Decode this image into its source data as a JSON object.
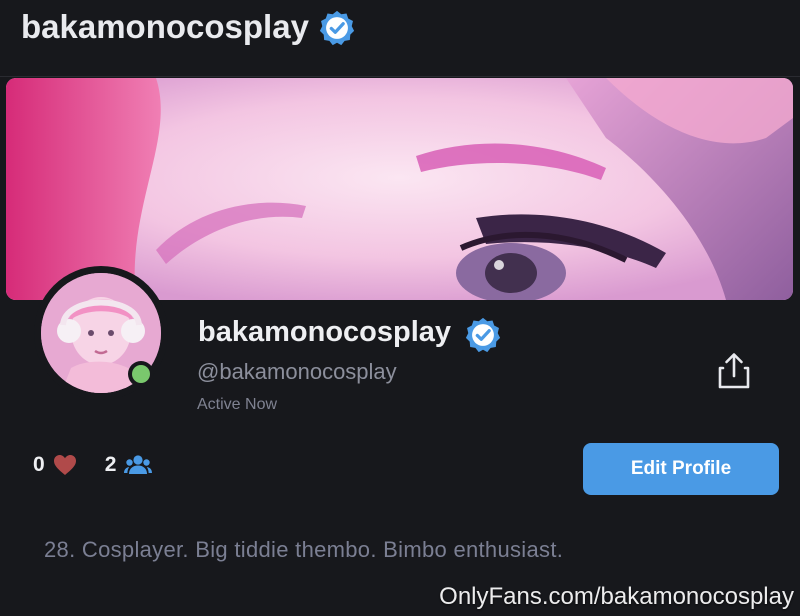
{
  "header": {
    "title": "bakamonocosplay",
    "verified_icon": "verified-badge-icon"
  },
  "profile": {
    "display_name": "bakamonocosplay",
    "handle": "@bakamonocosplay",
    "status": "Active Now",
    "online": true
  },
  "stats": {
    "likes": "0",
    "likes_icon": "heart-icon",
    "fans": "2",
    "fans_icon": "users-icon"
  },
  "actions": {
    "edit_profile_label": "Edit Profile",
    "share_icon": "share-icon"
  },
  "bio": "28. Cosplayer. Big tiddie thembo. Bimbo enthusiast.",
  "watermark": "OnlyFans.com/bakamonocosplay",
  "colors": {
    "background": "#17181c",
    "accent": "#4a9ae5",
    "online": "#7ac86d",
    "heart": "#b04a4a",
    "fans_icon": "#4a9ae5"
  }
}
